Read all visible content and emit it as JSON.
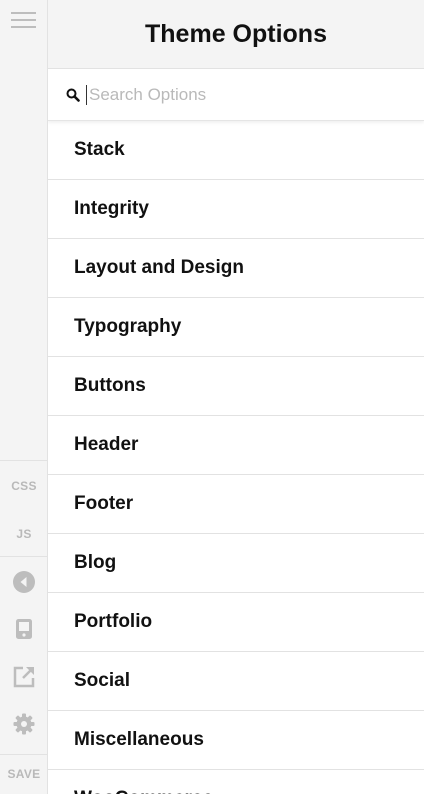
{
  "sidebar": {
    "menu_icon": "hamburger-icon",
    "css_label": "CSS",
    "js_label": "JS",
    "icons": [
      "back-arrow-icon",
      "mobile-device-icon",
      "external-link-icon",
      "gear-icon"
    ],
    "save_label": "SAVE"
  },
  "header": {
    "title": "Theme Options"
  },
  "search": {
    "placeholder": "Search Options",
    "value": "",
    "icon": "search-icon"
  },
  "options": [
    {
      "label": "Stack"
    },
    {
      "label": "Integrity"
    },
    {
      "label": "Layout and Design"
    },
    {
      "label": "Typography"
    },
    {
      "label": "Buttons"
    },
    {
      "label": "Header"
    },
    {
      "label": "Footer"
    },
    {
      "label": "Blog"
    },
    {
      "label": "Portfolio"
    },
    {
      "label": "Social"
    },
    {
      "label": "Miscellaneous"
    },
    {
      "label": "WooCommerce"
    }
  ],
  "colors": {
    "rail_bg": "#f4f4f4",
    "rail_icon": "#bdbdbd",
    "text": "#111111",
    "divider": "#e2e2e2"
  }
}
